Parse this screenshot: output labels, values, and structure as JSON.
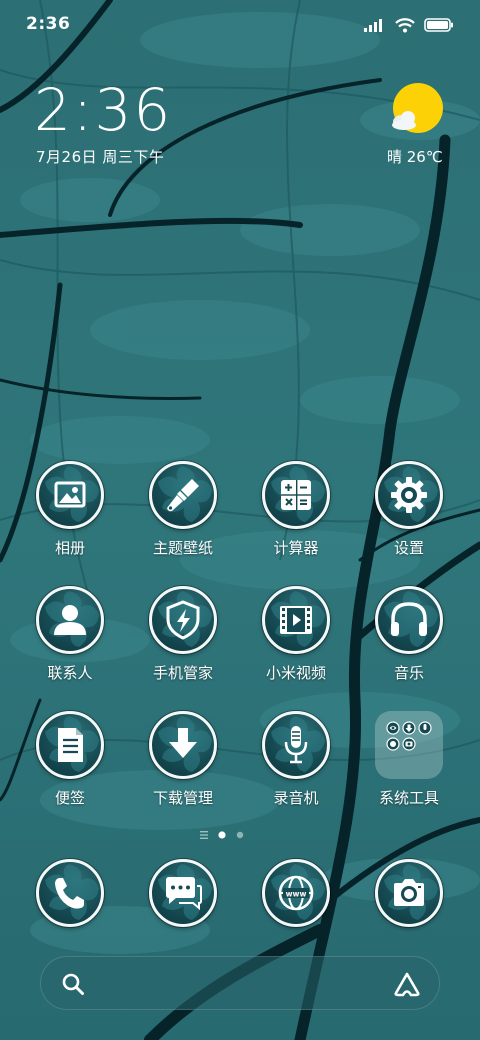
{
  "status_bar": {
    "time": "2:36",
    "signal_icon": "signal-bars-icon",
    "wifi_icon": "wifi-icon",
    "battery_icon": "battery-icon",
    "battery_level": 1.0
  },
  "clock_widget": {
    "time": "2:36",
    "date": "7月26日 周三下午"
  },
  "weather_widget": {
    "icon": "sun-cloud-icon",
    "text": "晴 26℃"
  },
  "apps": [
    {
      "label": "相册",
      "icon": "gallery-icon"
    },
    {
      "label": "主题壁纸",
      "icon": "paintbrush-icon"
    },
    {
      "label": "计算器",
      "icon": "calculator-icon"
    },
    {
      "label": "设置",
      "icon": "gear-icon"
    },
    {
      "label": "联系人",
      "icon": "contact-person-icon"
    },
    {
      "label": "手机管家",
      "icon": "shield-bolt-icon"
    },
    {
      "label": "小米视频",
      "icon": "video-film-icon"
    },
    {
      "label": "音乐",
      "icon": "headphones-icon"
    },
    {
      "label": "便签",
      "icon": "notes-icon"
    },
    {
      "label": "下载管理",
      "icon": "download-arrow-icon"
    },
    {
      "label": "录音机",
      "icon": "microphone-icon"
    },
    {
      "label": "系统工具",
      "icon": "folder-icon"
    }
  ],
  "page_indicator": {
    "pages": 2,
    "current": 1
  },
  "dock": [
    {
      "icon": "phone-icon"
    },
    {
      "icon": "messages-icon"
    },
    {
      "icon": "browser-globe-icon"
    },
    {
      "icon": "camera-icon"
    }
  ],
  "search_bar": {
    "left_icon": "search-icon",
    "right_icon": "assistant-icon"
  },
  "colors": {
    "wallpaper_base": "#2f7479",
    "icon_fill": "#164a52",
    "sun": "#fcd206"
  }
}
